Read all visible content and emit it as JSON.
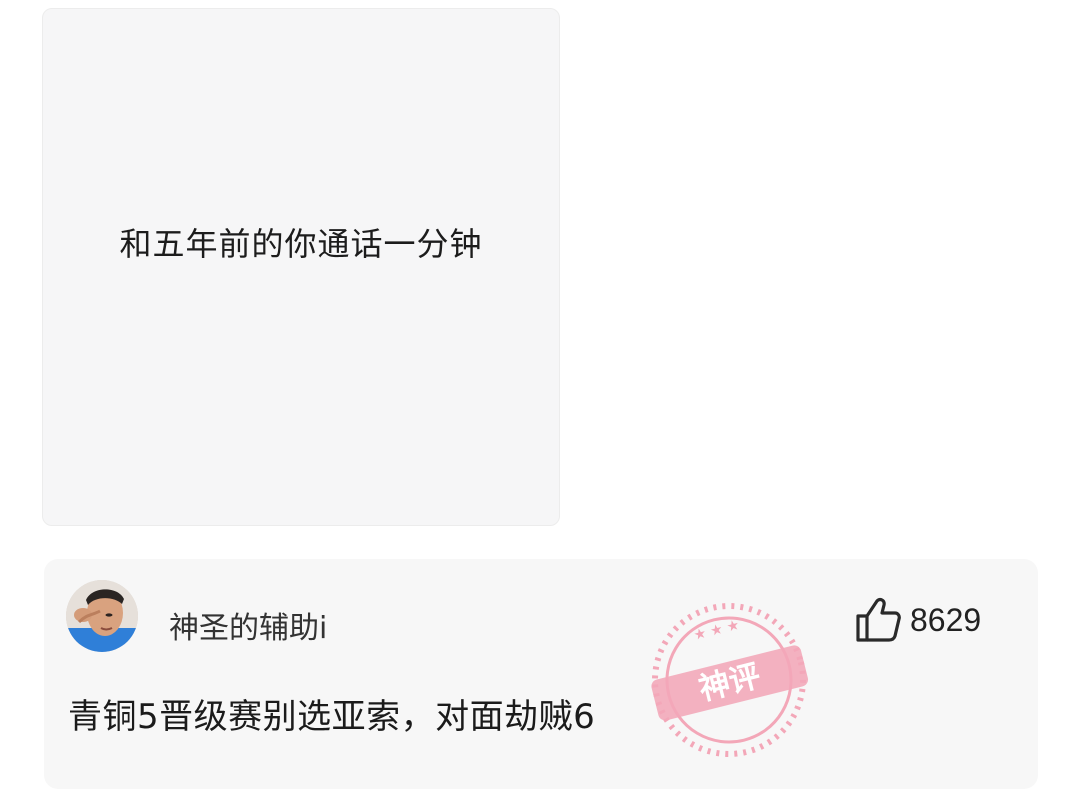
{
  "post": {
    "text": "和五年前的你通话一分钟"
  },
  "comment": {
    "username": "神圣的辅助i",
    "text": "青铜5晋级赛别选亚索，对面劫贼6",
    "likes": "8629",
    "avatar_icon": "user-avatar",
    "like_icon": "thumbs-up-icon",
    "stamp_text": "神评"
  },
  "colors": {
    "post_bg": "#f6f6f7",
    "comment_bg": "#f7f7f7",
    "stamp": "#f3a7b8"
  }
}
